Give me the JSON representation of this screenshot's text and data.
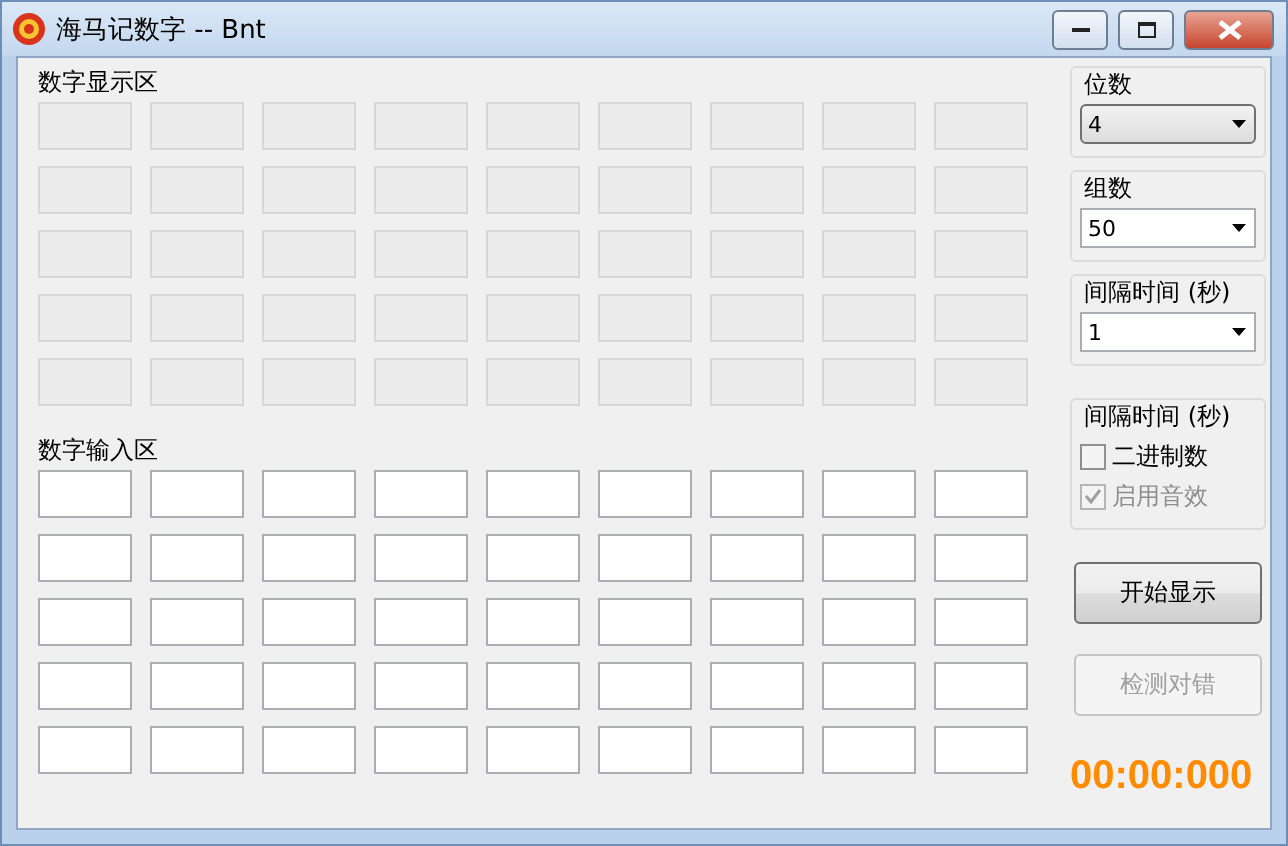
{
  "window": {
    "title": "海马记数字 -- Bnt"
  },
  "display_area": {
    "label": "数字显示区",
    "rows": [
      [
        {
          "disabled": true
        },
        {
          "disabled": true
        },
        {
          "disabled": true
        },
        {
          "disabled": true
        },
        {
          "disabled": true
        },
        {
          "disabled": true
        },
        {
          "disabled": true
        },
        {
          "disabled": true
        },
        {
          "disabled": true
        }
      ],
      [
        {
          "disabled": true
        },
        {
          "disabled": true
        },
        {
          "disabled": true
        },
        {
          "disabled": true
        },
        {
          "disabled": true
        },
        {
          "disabled": true
        },
        {
          "disabled": true
        },
        {
          "disabled": true
        },
        {
          "disabled": true
        }
      ],
      [
        {
          "disabled": true
        },
        {
          "disabled": true
        },
        {
          "disabled": true
        },
        {
          "disabled": true
        },
        {
          "disabled": true
        },
        {
          "disabled": true
        },
        {
          "disabled": true
        },
        {
          "disabled": true
        },
        {
          "disabled": true
        }
      ],
      [
        {
          "disabled": true
        },
        {
          "disabled": true
        },
        {
          "disabled": true
        },
        {
          "disabled": true
        },
        {
          "disabled": true
        },
        {
          "disabled": true
        },
        {
          "disabled": true
        },
        {
          "disabled": true
        },
        {
          "disabled": true
        }
      ],
      [
        {
          "disabled": true
        },
        {
          "disabled": true
        },
        {
          "disabled": true
        },
        {
          "disabled": true
        },
        {
          "disabled": true
        },
        {
          "disabled": true
        },
        {
          "disabled": true
        },
        {
          "disabled": true
        },
        {
          "disabled": true
        }
      ]
    ]
  },
  "input_area": {
    "label": "数字输入区",
    "rows": [
      [
        {
          "disabled": false
        },
        {
          "disabled": false
        },
        {
          "disabled": false
        },
        {
          "disabled": false
        },
        {
          "disabled": false
        },
        {
          "disabled": false
        },
        {
          "disabled": false
        },
        {
          "disabled": false
        },
        {
          "disabled": false
        }
      ],
      [
        {
          "disabled": false
        },
        {
          "disabled": false
        },
        {
          "disabled": false
        },
        {
          "disabled": false
        },
        {
          "disabled": false
        },
        {
          "disabled": false
        },
        {
          "disabled": false
        },
        {
          "disabled": false
        },
        {
          "disabled": false
        }
      ],
      [
        {
          "disabled": false
        },
        {
          "disabled": false
        },
        {
          "disabled": false
        },
        {
          "disabled": false
        },
        {
          "disabled": false
        },
        {
          "disabled": false
        },
        {
          "disabled": false
        },
        {
          "disabled": false
        },
        {
          "disabled": false
        }
      ],
      [
        {
          "disabled": false
        },
        {
          "disabled": false
        },
        {
          "disabled": false
        },
        {
          "disabled": false
        },
        {
          "disabled": false
        },
        {
          "disabled": false
        },
        {
          "disabled": false
        },
        {
          "disabled": false
        },
        {
          "disabled": false
        }
      ],
      [
        {
          "disabled": false
        },
        {
          "disabled": false
        },
        {
          "disabled": false
        },
        {
          "disabled": false
        },
        {
          "disabled": false
        },
        {
          "disabled": false
        },
        {
          "disabled": false
        },
        {
          "disabled": false
        },
        {
          "disabled": false
        }
      ]
    ]
  },
  "settings": [
    {
      "label": "位数",
      "value": "4",
      "focused": true
    },
    {
      "label": "组数",
      "value": "50",
      "focused": false
    },
    {
      "label": "间隔时间 (秒)",
      "value": "1",
      "focused": false
    }
  ],
  "options": {
    "label": "间隔时间 (秒)",
    "items": [
      {
        "label": "二进制数",
        "checked": false,
        "disabled": false
      },
      {
        "label": "启用音效",
        "checked": true,
        "disabled": true
      }
    ]
  },
  "buttons": [
    {
      "label": "开始显示",
      "disabled": false
    },
    {
      "label": "检测对错",
      "disabled": true
    }
  ],
  "timer": "00:00:000"
}
